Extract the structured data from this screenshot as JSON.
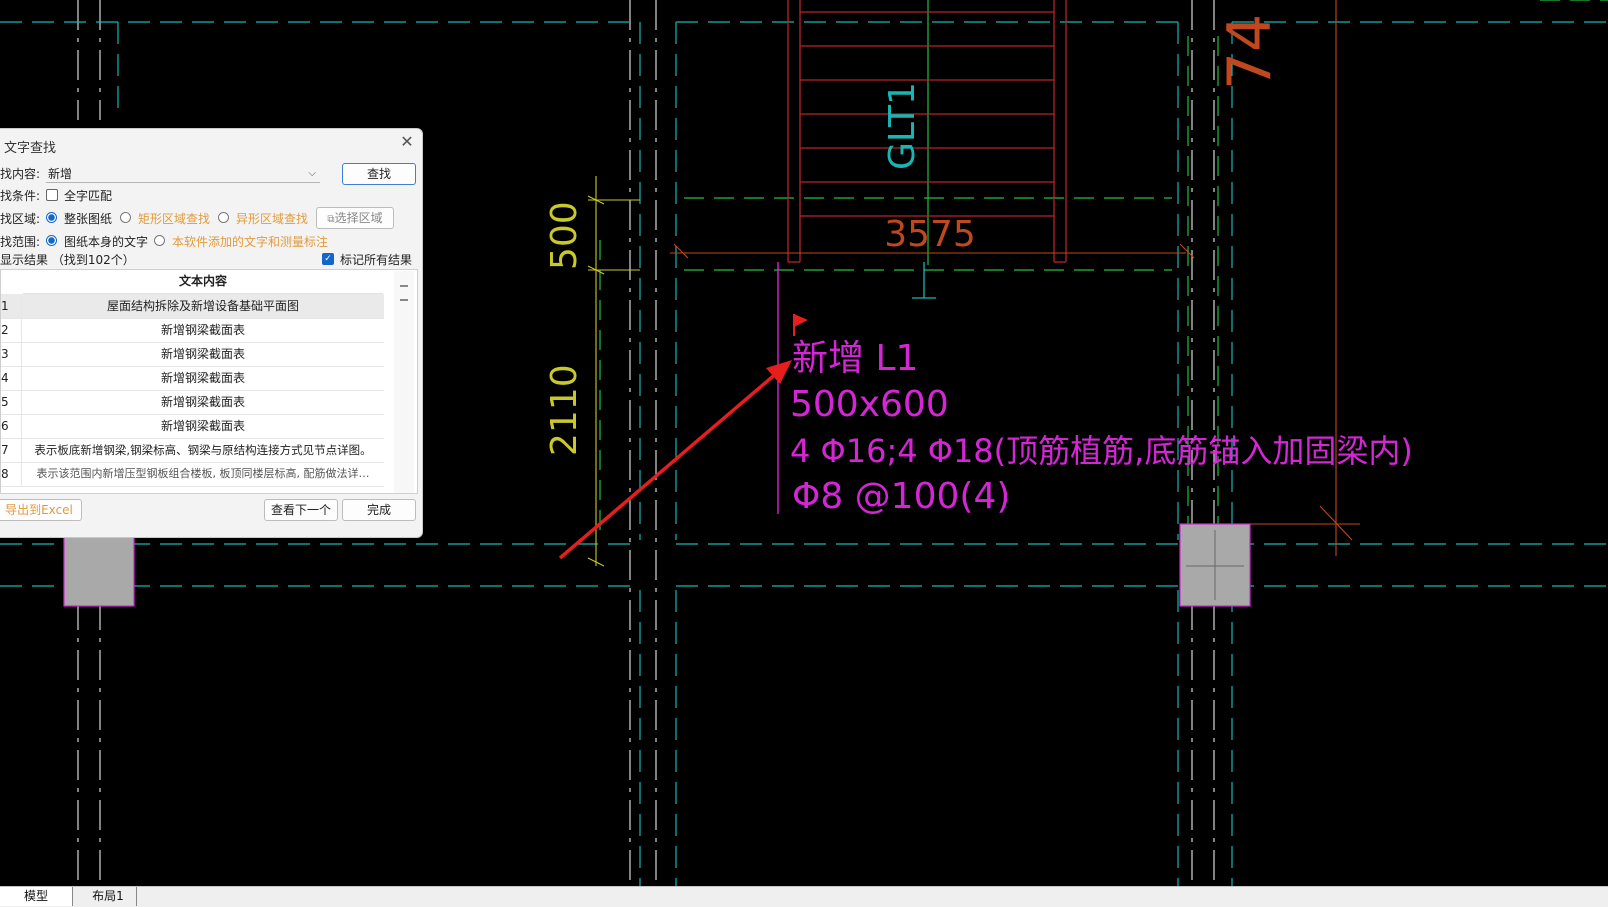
{
  "dialog": {
    "title": "文字查找",
    "close_glyph": "✕",
    "find_label": "找内容:",
    "find_value": "新增",
    "find_button": "查找",
    "condition_label": "找条件:",
    "whole_word": "全字匹配",
    "area_label": "找区域:",
    "area_options": [
      "整张图纸",
      "矩形区域查找",
      "异形区域查找"
    ],
    "select_area_button": "选择区域",
    "scope_label": "找范围:",
    "scope_options": [
      "图纸本身的文字",
      "本软件添加的文字和测量标注"
    ],
    "result_label": "显示结果 （找到102个）",
    "mark_all_label": "标记所有结果",
    "table_header": "文本内容",
    "rows": [
      {
        "num": "1",
        "text": "屋面结构拆除及新增设备基础平面图"
      },
      {
        "num": "2",
        "text": "新增钢梁截面表"
      },
      {
        "num": "3",
        "text": "新增钢梁截面表"
      },
      {
        "num": "4",
        "text": "新增钢梁截面表"
      },
      {
        "num": "5",
        "text": "新增钢梁截面表"
      },
      {
        "num": "6",
        "text": "新增钢梁截面表"
      },
      {
        "num": "7",
        "text": "表示板底新增钢梁,钢梁标高、钢梁与原结构连接方式见节点详图。"
      },
      {
        "num": "8",
        "text": "表示该范围内新增压型钢板组合楼板, 板顶同楼层标高, 配筋做法详…"
      }
    ],
    "export_button": "导出到Excel",
    "next_button": "查看下一个",
    "done_button": "完成"
  },
  "drawing": {
    "dim_top": "3575",
    "dim_left_500": "500",
    "dim_left_2110": "2110",
    "stair_label": "GLT1",
    "corner_text": "74",
    "beam_name": "新增  L1",
    "beam_size": "500x600",
    "beam_rebar": "4 Φ16;4 Φ18(顶筋植筋,底筋锚入加固梁内)",
    "beam_stirrup": "Φ8 @100(4)",
    "colors": {
      "magenta": "#d426d4",
      "cyan": "#19b5b5",
      "green": "#1fbf3f",
      "yellow": "#c9c92a",
      "red": "#b8242a",
      "orange": "#c0481e",
      "white_dash": "#d8d8d8",
      "arrow": "#e61e1e"
    }
  },
  "tabs": [
    "模型",
    "布局1"
  ]
}
